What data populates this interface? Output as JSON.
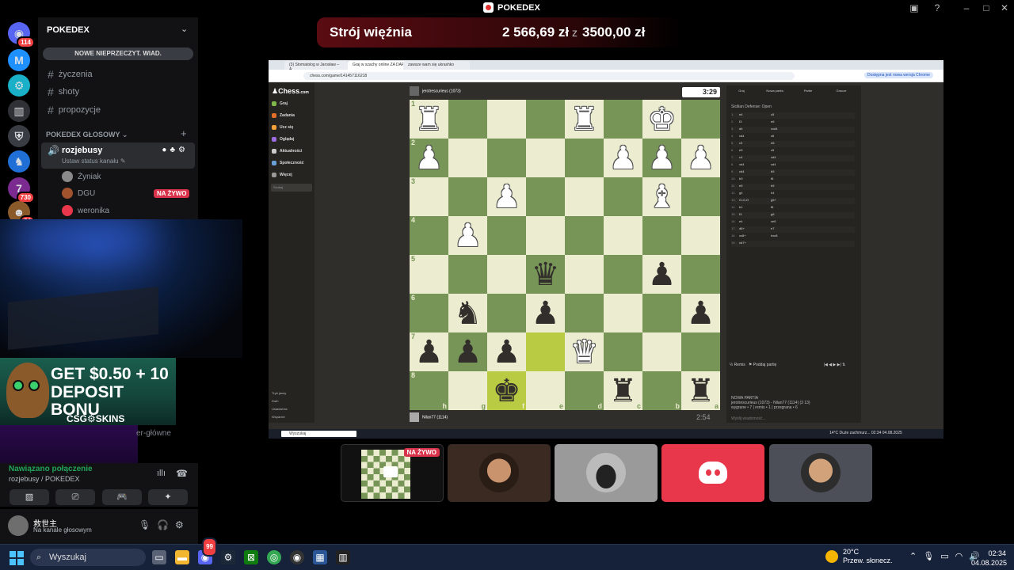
{
  "window": {
    "title": "POKEDEX"
  },
  "servers": [
    {
      "badge": "114",
      "color": "#5865f2"
    },
    {
      "badge": "",
      "color": "#1e90ff"
    },
    {
      "badge": "",
      "color": "#1ab0c8"
    },
    {
      "badge": "",
      "color": "#2f3136"
    },
    {
      "badge": "",
      "color": "#3a3c43"
    },
    {
      "badge": "",
      "color": "#1f6fd6"
    },
    {
      "badge": "730",
      "color": "#7b2a8f"
    },
    {
      "badge": "84",
      "color": "#8b5a2b"
    }
  ],
  "sidebar": {
    "server_name": "POKEDEX",
    "new_messages": "NOWE NIEPRZECZYT. WIAD.",
    "text_channels": [
      "życzenia",
      "shoty",
      "propozycje"
    ],
    "voice_category": "POKEDEX GŁOSOWY",
    "voice_channel": {
      "name": "rozjebusy",
      "status": "Ustaw status kanału"
    },
    "voice_users": [
      {
        "name": "Żyniak",
        "live": "NA ŻYWO"
      },
      {
        "name": "DGU",
        "live": ""
      },
      {
        "name": "weronika",
        "live": ""
      }
    ],
    "hidden_channel": "er-główne"
  },
  "ad": {
    "line1": "GET $0.50 + 10",
    "line2": "DEPOSIT BONU",
    "brand": "CSG⚙SKINS"
  },
  "voice_connection": {
    "status": "Nawiązano połączenie",
    "location": "rozjebusy / POKEDEX"
  },
  "user": {
    "name": "救世主",
    "status": "Na kanale głosowym"
  },
  "donation": {
    "title": "Strój więźnia",
    "amount": "2 566,69 zł",
    "separator": "z",
    "goal": "3500,00 zł"
  },
  "stream": {
    "tabs": [
      "(3) Stomatolog w Jarosław – A...",
      "Graj w szachy online ZA DARM...",
      "zawsze wam się ukrashko"
    ],
    "url": "chess.com/game/141457116218",
    "update_btn": "Dostępna jest nowa wersja Chrome",
    "chess_nav": [
      "Graj",
      "Zadania",
      "Ucz się",
      "Oglądaj",
      "Aktualności",
      "Społeczność",
      "Więcej"
    ],
    "chess_search": "Szukaj",
    "chess_footer": [
      "Tryb jasny",
      "Zwiń",
      "Ustawienia",
      "Wsparcie"
    ],
    "top_player": "jerotrescurieus (1073)",
    "top_clock": "3:29",
    "bottom_player": "Nilan77 (1114)",
    "bottom_clock": "2:54",
    "right_tabs": [
      "Graj",
      "Nowa partia",
      "Partie",
      "Gracze"
    ],
    "opening": "Sicilian Defense: Open",
    "moves": [
      [
        "1.",
        "e4",
        "c5"
      ],
      [
        "2.",
        "f3",
        "e6"
      ],
      [
        "3.",
        "d4",
        "cxd4"
      ],
      [
        "4.",
        "xd4",
        "c6"
      ],
      [
        "5.",
        "c3",
        "e6"
      ],
      [
        "6.",
        "e5",
        "c5"
      ],
      [
        "7.",
        "c4",
        "xd4"
      ],
      [
        "8.",
        "xd4",
        "xd4"
      ],
      [
        "9.",
        "xd4",
        "b5"
      ],
      [
        "10.",
        "b3",
        "f6"
      ],
      [
        "11.",
        "e5",
        "h5"
      ],
      [
        "12.",
        "g4",
        "h4"
      ],
      [
        "13.",
        "O-O-O",
        "g5+"
      ],
      [
        "14.",
        "b1",
        "f6"
      ],
      [
        "15.",
        "f3",
        "g6"
      ],
      [
        "16.",
        "e4",
        "xe5"
      ],
      [
        "17.",
        "d6+",
        "e7"
      ],
      [
        "18.",
        "xc8+",
        "hxc8"
      ],
      [
        "19.",
        "xd7+",
        ""
      ]
    ],
    "remis": "Remis",
    "resign": "Poddaj partię",
    "new_game_title": "NOWA PARTIA",
    "new_game_players": "jerotrescurieus (1073) - Nilan77 (1114) (3 13)",
    "new_game_score": "wygrane • 7 | remis • 1 | przegrana • 6",
    "chat_placeholder": "Wyślij wiadomość...",
    "taskbar_search": "Wyszukaj",
    "taskbar_right": "14°C Duże zachmurz...   02:34  04.08.2025",
    "ranks": [
      "1",
      "2",
      "3",
      "4",
      "5",
      "6",
      "7",
      "8"
    ],
    "files": [
      "h",
      "g",
      "f",
      "e",
      "d",
      "c",
      "b",
      "a"
    ],
    "board": [
      [
        "wR",
        "",
        "",
        "",
        "wR",
        "",
        "wK",
        ""
      ],
      [
        "wP",
        "",
        "",
        "",
        "",
        "wP",
        "wP",
        "wP"
      ],
      [
        "",
        "",
        "wP",
        "",
        "",
        "",
        "wB",
        ""
      ],
      [
        "",
        "wP",
        "",
        "",
        "",
        "",
        "",
        ""
      ],
      [
        "",
        "",
        "",
        "bQ",
        "",
        "",
        "bP",
        ""
      ],
      [
        "",
        "bN",
        "",
        "bP",
        "",
        "",
        "",
        "bP"
      ],
      [
        "bP",
        "bP",
        "bP",
        "",
        "wQ",
        "",
        "",
        ""
      ],
      [
        "",
        "",
        "bK",
        "",
        "",
        "bR",
        "",
        "bR"
      ]
    ]
  },
  "tiles": [
    {
      "live": "NA ŻYWO"
    }
  ],
  "taskbar": {
    "search": "Wyszukaj",
    "discord_badge": "99",
    "weather_temp": "20°C",
    "weather_desc": "Przew. słonecz.",
    "time": "02:34",
    "date": "04.08.2025"
  }
}
